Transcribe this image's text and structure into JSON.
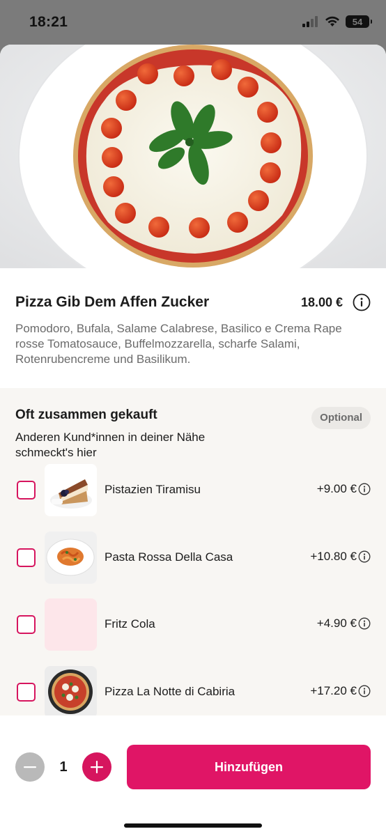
{
  "status_bar": {
    "time": "18:21",
    "battery": "54",
    "icons": [
      "signal-icon",
      "wifi-icon",
      "battery-icon"
    ]
  },
  "product": {
    "title": "Pizza Gib Dem Affen Zucker",
    "price": "18.00 €",
    "description": "Pomodoro, Bufala, Salame Calabrese, Basilico e Crema Rape rosse Tomatosauce, Buffelmozzarella, scharfe Salami, Rotenrubencreme und Basilikum."
  },
  "upsell": {
    "title": "Oft zusammen gekauft",
    "badge": "Optional",
    "subtitle": "Anderen Kund*innen in deiner Nähe schmeckt's hier",
    "items": [
      {
        "name": "Pistazien Tiramisu",
        "price": "+9.00 €",
        "checked": false
      },
      {
        "name": "Pasta Rossa Della Casa",
        "price": "+10.80 €",
        "checked": false
      },
      {
        "name": "Fritz Cola",
        "price": "+4.90 €",
        "checked": false
      },
      {
        "name": "Pizza La Notte di Cabiria",
        "price": "+17.20 €",
        "checked": false
      }
    ]
  },
  "footer": {
    "quantity": "1",
    "add_label": "Hinzufügen"
  },
  "colors": {
    "accent": "#e01566",
    "checkbox_border": "#d6155e",
    "upsell_bg": "#f8f6f3",
    "minus_disabled": "#b9b9b9"
  }
}
